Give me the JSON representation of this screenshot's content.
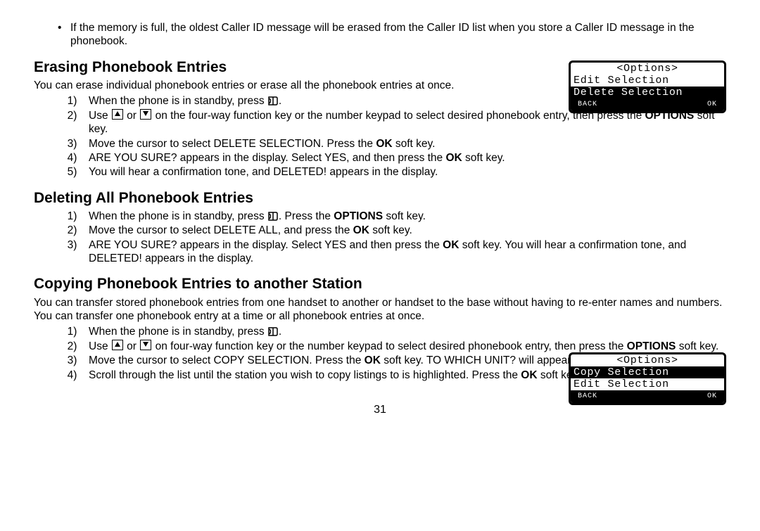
{
  "note_bullet": "If the memory is full, the oldest Caller ID message will be erased from the Caller ID list when you store a Caller ID message in the phonebook.",
  "sec1": {
    "heading": "Erasing Phonebook Entries",
    "intro": "You can erase individual phonebook entries or erase all the phonebook entries at once.",
    "s1a": "When the phone is in standby, press ",
    "s1b": ".",
    "s2a": "Use ",
    "s2b": " or ",
    "s2c": " on the four-way function key or the number keypad to select desired phonebook entry, then press the ",
    "s2d": " soft key.",
    "options": "OPTIONS",
    "s3a": "Move the cursor to select DELETE SELECTION. Press the ",
    "s3b": " soft key.",
    "ok": "OK",
    "s4a": "ARE YOU SURE? appears in the display. Select YES, and then press the ",
    "s4b": " soft key.",
    "s5": "You will hear a confirmation tone, and DELETED! appears in the display."
  },
  "sec2": {
    "heading": "Deleting All Phonebook Entries",
    "s1a": "When the phone is in standby, press ",
    "s1b": ". Press the ",
    "s1c": " soft key.",
    "s2a": "Move the cursor to select DELETE ALL, and press the ",
    "s2b": " soft key.",
    "s3a": "ARE YOU SURE? appears in the display. Select YES and then press the ",
    "s3b": " soft key. You will hear a confirmation tone, and DELETED! appears in the display."
  },
  "sec3": {
    "heading": "Copying Phonebook Entries to another Station",
    "intro": "You can transfer stored phonebook entries from one handset to another or handset to the base without having to re-enter names and numbers. You can transfer one phonebook entry at a time or all phonebook entries at once.",
    "s1a": "When the phone is in standby, press ",
    "s1b": ".",
    "s2a": "Use ",
    "s2b": " or ",
    "s2c": " on four-way function key or the number keypad to select desired phonebook entry, then press the ",
    "s2d": " soft key.",
    "s3a": "Move the cursor to select COPY SELECTION. Press the ",
    "s3b": " soft key. TO WHICH UNIT? will appear.",
    "s4a": "Scroll through the list until the station you wish to copy listings to is highlighted. Press the ",
    "s4b": " soft key."
  },
  "lcd1": {
    "title": "<Options>",
    "row2": "Edit Selection",
    "row3": "Delete Selection",
    "back": "BACK",
    "ok": "OK"
  },
  "lcd2": {
    "title": "<Options>",
    "row2": "Copy Selection",
    "row3": "Edit Selection",
    "back": "BACK",
    "ok": "OK"
  },
  "page": "31"
}
